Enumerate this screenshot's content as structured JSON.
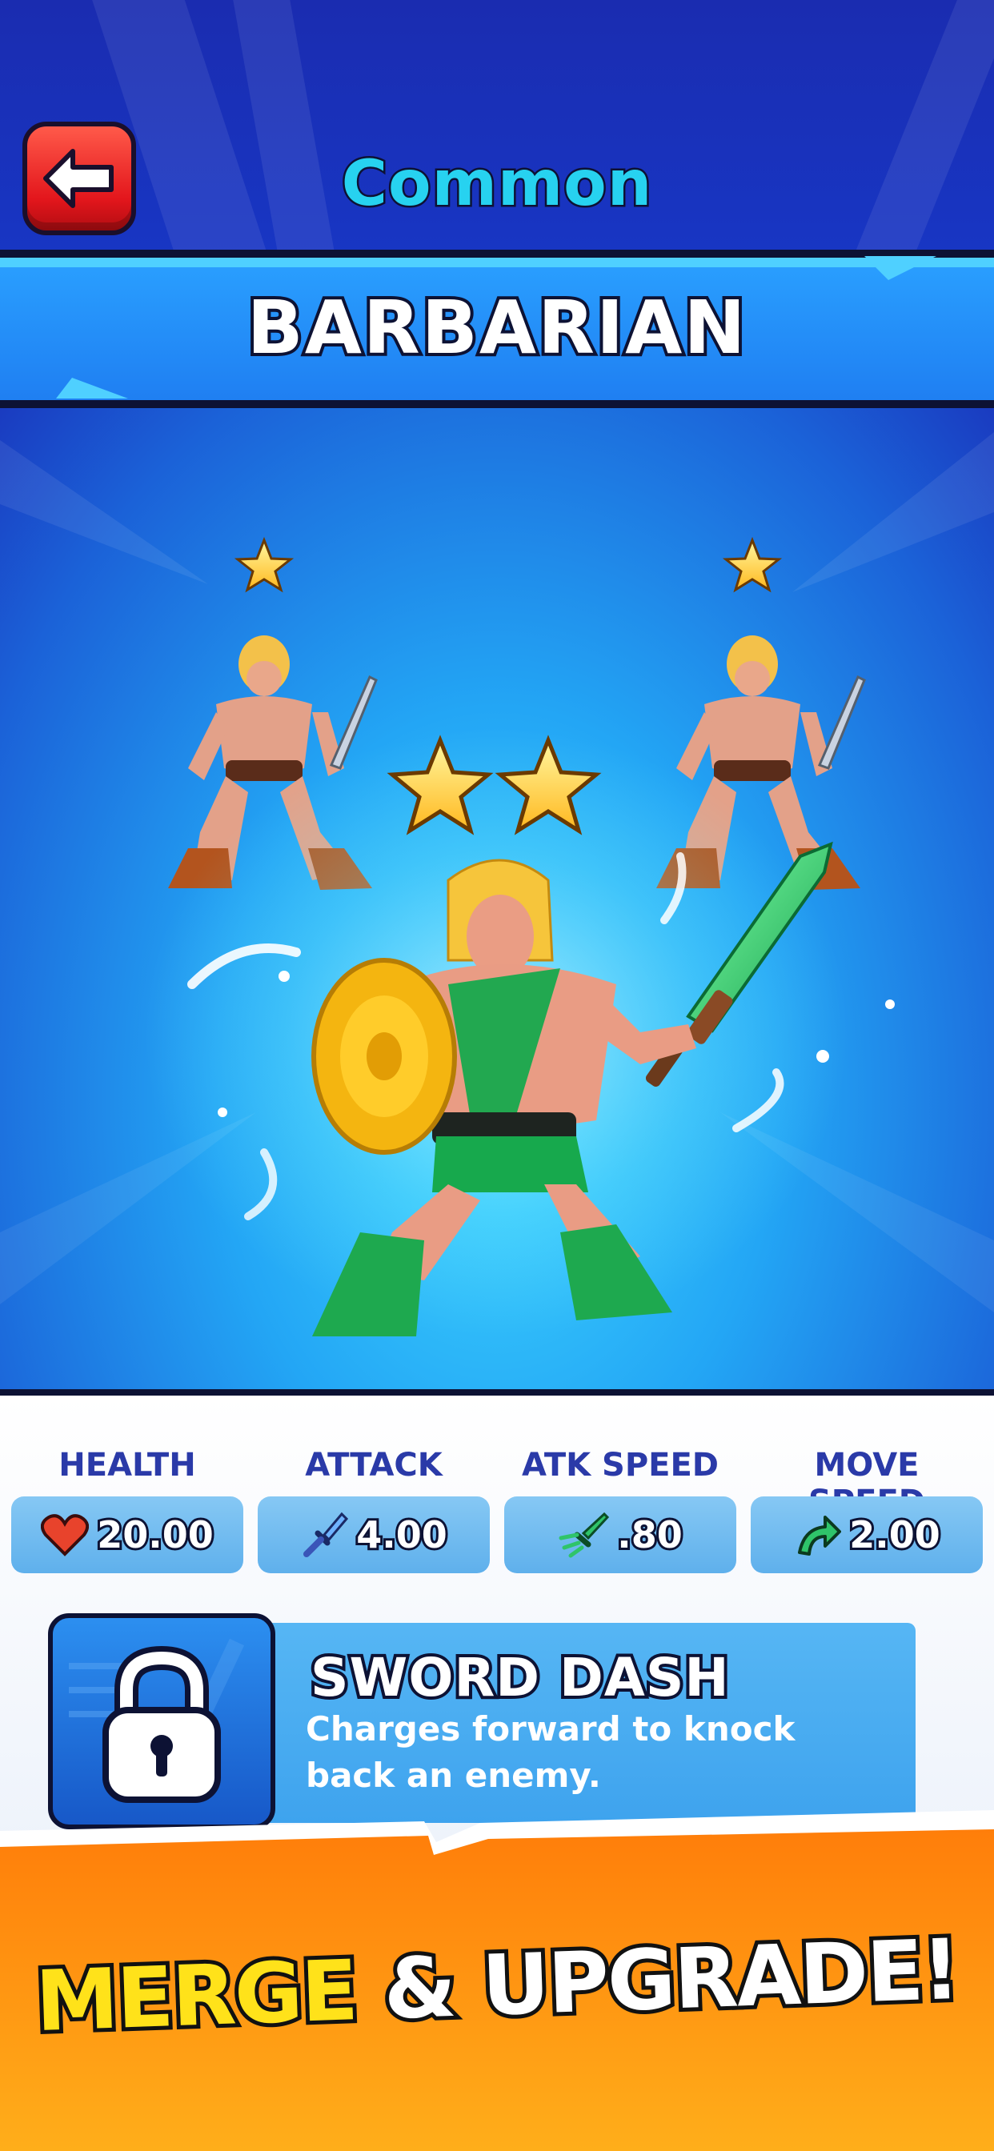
{
  "header": {
    "rarity": "Common",
    "back_icon": "back-arrow-icon"
  },
  "unit": {
    "name": "BARBARIAN",
    "merge_preview": {
      "source_stars": [
        1,
        1
      ],
      "result_stars": 2
    }
  },
  "stats": [
    {
      "label": "HEALTH",
      "value": "20.00",
      "icon": "heart-icon"
    },
    {
      "label": "ATTACK",
      "value": "4.00",
      "icon": "sword-icon"
    },
    {
      "label": "ATK SPEED",
      "value": ".80",
      "icon": "swift-sword-icon"
    },
    {
      "label": "MOVE SPEED",
      "value": "2.00",
      "icon": "boot-arrow-icon"
    }
  ],
  "ability": {
    "name": "SWORD DASH",
    "description": "Charges forward to knock back an enemy.",
    "locked": true,
    "icon": "padlock-icon"
  },
  "footer": {
    "merge_word": "MERGE",
    "rest_words": " & UPGRADE!"
  },
  "colors": {
    "header_bg": "#1a2cb0",
    "rarity_text": "#27d2f0",
    "banner_bg": "#1f7ff2",
    "stat_box": "#6ab8ef",
    "stat_label": "#2a3aa8",
    "footer_orange": "#ff8a0a",
    "merge_yellow": "#ffe21a"
  }
}
